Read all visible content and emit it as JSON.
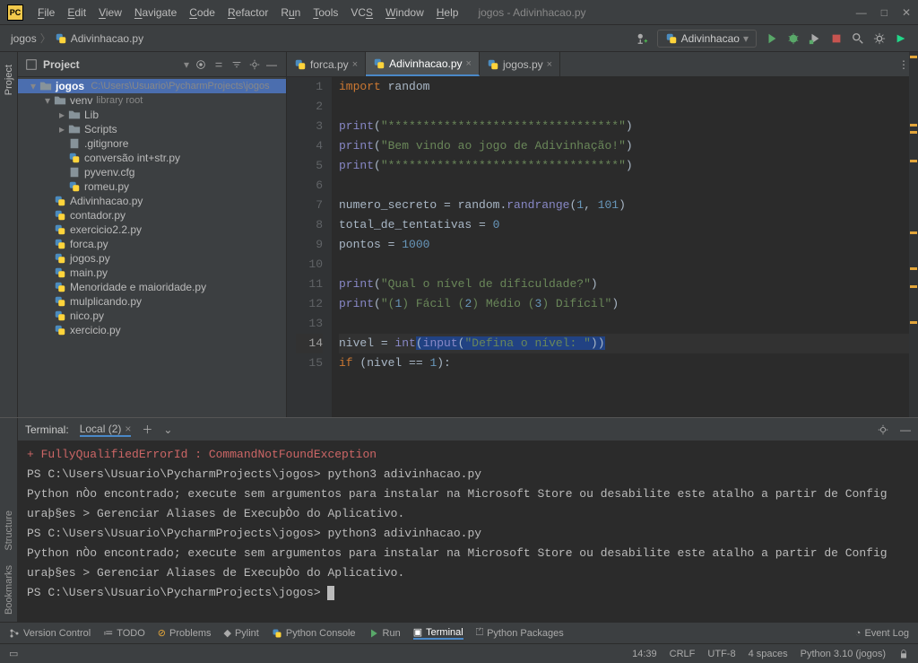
{
  "app": {
    "title": "jogos - Adivinhacao.py",
    "logo": "PC"
  },
  "menu": [
    "File",
    "Edit",
    "View",
    "Navigate",
    "Code",
    "Refactor",
    "Run",
    "Tools",
    "VCS",
    "Window",
    "Help"
  ],
  "breadcrumb": {
    "a": "jogos",
    "b": "Adivinhacao.py"
  },
  "run_config": {
    "label": "Adivinhacao"
  },
  "project": {
    "title": "Project",
    "root": {
      "name": "jogos",
      "path": "C:\\Users\\Usuario\\PycharmProjects\\jogos"
    },
    "venv": {
      "name": "venv",
      "hint": "library root"
    },
    "venv_children": [
      "Lib",
      "Scripts",
      ".gitignore",
      "conversão int+str.py",
      "pyvenv.cfg",
      "romeu.py"
    ],
    "files": [
      "Adivinhacao.py",
      "contador.py",
      "exercicio2.2.py",
      "forca.py",
      "jogos.py",
      "main.py",
      "Menoridade e maioridade.py",
      "mulplicando.py",
      "nico.py",
      "xercicio.py"
    ]
  },
  "tabs": [
    {
      "label": "forca.py",
      "active": false
    },
    {
      "label": "Adivinhacao.py",
      "active": true
    },
    {
      "label": "jogos.py",
      "active": false
    }
  ],
  "code": {
    "lines": [
      {
        "n": 1,
        "t": "import random"
      },
      {
        "n": 2,
        "t": ""
      },
      {
        "n": 3,
        "t": "print(\"*********************************\")"
      },
      {
        "n": 4,
        "t": "print(\"Bem vindo ao jogo de Adivinhação!\")"
      },
      {
        "n": 5,
        "t": "print(\"*********************************\")"
      },
      {
        "n": 6,
        "t": ""
      },
      {
        "n": 7,
        "t": "numero_secreto = random.randrange(1, 101)"
      },
      {
        "n": 8,
        "t": "total_de_tentativas = 0"
      },
      {
        "n": 9,
        "t": "pontos = 1000"
      },
      {
        "n": 10,
        "t": ""
      },
      {
        "n": 11,
        "t": "print(\"Qual o nível de dificuldade?\")"
      },
      {
        "n": 12,
        "t": "print(\"(1) Fácil (2) Médio (3) Difícil\")"
      },
      {
        "n": 13,
        "t": ""
      },
      {
        "n": 14,
        "t": "nivel = int(input(\"Defina o nível: \"))"
      },
      {
        "n": 15,
        "t": "if (nivel == 1):"
      }
    ],
    "highlight": 14
  },
  "terminal": {
    "title": "Terminal:",
    "tab": "Local (2)",
    "lines": [
      {
        "cls": "err",
        "t": "    + FullyQualifiedErrorId : CommandNotFoundException"
      },
      {
        "cls": "",
        "t": ""
      },
      {
        "cls": "prompt",
        "t": "PS C:\\Users\\Usuario\\PycharmProjects\\jogos> python3 adivinhacao.py"
      },
      {
        "cls": "",
        "t": "Python nÒo encontrado; execute sem argumentos para instalar na Microsoft Store ou desabilite este atalho a partir de Config"
      },
      {
        "cls": "",
        "t": "uraþ§es > Gerenciar Aliases de ExecuþÒo do Aplicativo."
      },
      {
        "cls": "prompt",
        "t": "PS C:\\Users\\Usuario\\PycharmProjects\\jogos> python3 adivinhacao.py"
      },
      {
        "cls": "",
        "t": "Python nÒo encontrado; execute sem argumentos para instalar na Microsoft Store ou desabilite este atalho a partir de Config"
      },
      {
        "cls": "",
        "t": "uraþ§es > Gerenciar Aliases de ExecuþÒo do Aplicativo."
      },
      {
        "cls": "prompt",
        "t": "PS C:\\Users\\Usuario\\PycharmProjects\\jogos> "
      }
    ]
  },
  "tool_tabs": [
    "Version Control",
    "TODO",
    "Problems",
    "Pylint",
    "Python Console",
    "Run",
    "Terminal",
    "Python Packages"
  ],
  "tool_tabs_right": "Event Log",
  "status": {
    "pos": "14:39",
    "enc": "CRLF",
    "charset": "UTF-8",
    "indent": "4 spaces",
    "interpreter": "Python 3.10 (jogos)"
  }
}
